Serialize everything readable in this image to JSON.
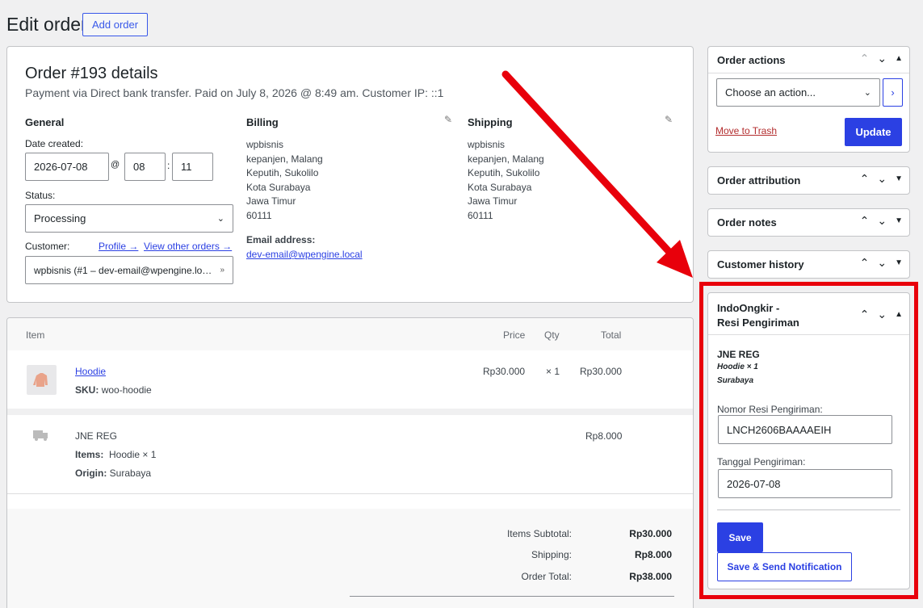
{
  "header": {
    "title": "Edit order",
    "add_order": "Add order"
  },
  "order": {
    "title": "Order #193 details",
    "subtitle": "Payment via Direct bank transfer. Paid on July 8, 2026 @ 8:49 am. Customer IP: ::1",
    "general": {
      "heading": "General",
      "date_label": "Date created:",
      "date": "2026-07-08",
      "at": "@",
      "hour": "08",
      "colon": ":",
      "minute": "11",
      "status_label": "Status:",
      "status": "Processing",
      "customer_label": "Customer:",
      "profile_link": "Profile →",
      "other_orders_link": "View other orders →",
      "customer": "wpbisnis (#1 – dev-email@wpengine.lo…"
    },
    "billing": {
      "heading": "Billing",
      "lines": [
        "wpbisnis",
        "kepanjen, Malang",
        "Keputih, Sukolilo",
        "Kota Surabaya",
        "Jawa Timur",
        "60111"
      ],
      "email_label": "Email address:",
      "email": "dev-email@wpengine.local"
    },
    "shipping": {
      "heading": "Shipping",
      "lines": [
        "wpbisnis",
        "kepanjen, Malang",
        "Keputih, Sukolilo",
        "Kota Surabaya",
        "Jawa Timur",
        "60111"
      ]
    }
  },
  "items": {
    "headers": {
      "item": "Item",
      "price": "Price",
      "qty": "Qty",
      "total": "Total"
    },
    "product": {
      "name": "Hoodie",
      "sku_label": "SKU:",
      "sku": "woo-hoodie",
      "price": "Rp30.000",
      "qty": "× 1",
      "total": "Rp30.000"
    },
    "shipping_line": {
      "name": "JNE REG",
      "items_label": "Items:",
      "items": "Hoodie × 1",
      "origin_label": "Origin:",
      "origin": "Surabaya",
      "total": "Rp8.000"
    },
    "totals": {
      "subtotal_label": "Items Subtotal:",
      "subtotal": "Rp30.000",
      "shipping_label": "Shipping:",
      "shipping": "Rp8.000",
      "total_label": "Order Total:",
      "total": "Rp38.000"
    }
  },
  "sidebar": {
    "order_actions": {
      "title": "Order actions",
      "select": "Choose an action...",
      "go": "›",
      "trash": "Move to Trash",
      "update": "Update"
    },
    "attribution": {
      "title": "Order attribution"
    },
    "notes": {
      "title": "Order notes"
    },
    "history": {
      "title": "Customer history"
    },
    "indoongkir": {
      "title_line1": "IndoOngkir -",
      "title_line2": "Resi Pengiriman",
      "courier": "JNE REG",
      "items": "Hoodie × 1",
      "origin": "Surabaya",
      "resi_label": "Nomor Resi Pengiriman:",
      "resi_value": "LNCH2606BAAAAEIH",
      "date_label": "Tanggal Pengiriman:",
      "date_value": "2026-07-08",
      "save": "Save",
      "save_send": "Save & Send Notification"
    }
  },
  "colors": {
    "accent": "#2b40e3",
    "highlight": "#e8000b",
    "link": "#2271b1"
  }
}
